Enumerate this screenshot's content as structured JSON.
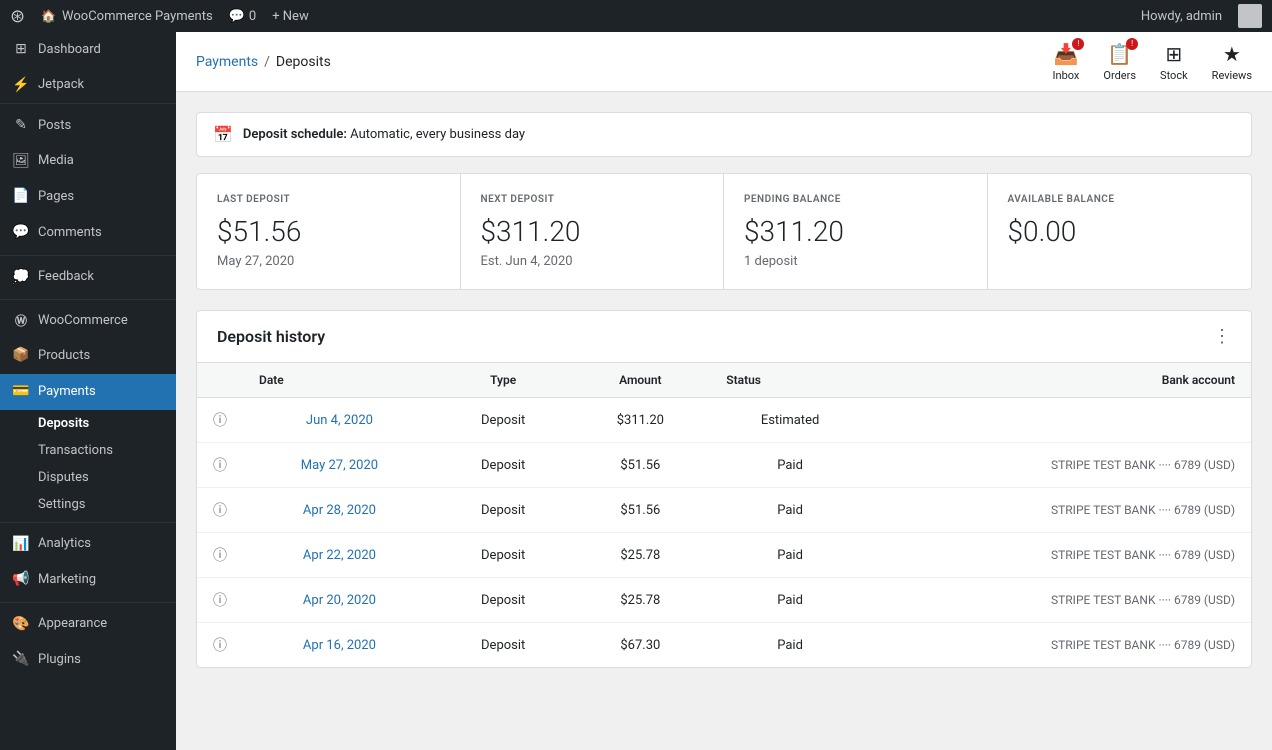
{
  "adminbar": {
    "logo": "W",
    "site_name": "WooCommerce Payments",
    "comments_label": "0",
    "new_label": "+ New",
    "user_label": "Howdy, admin"
  },
  "sidebar": {
    "items": [
      {
        "id": "dashboard",
        "label": "Dashboard",
        "icon": "⊞"
      },
      {
        "id": "jetpack",
        "label": "Jetpack",
        "icon": "⚡"
      },
      {
        "id": "posts",
        "label": "Posts",
        "icon": "✎"
      },
      {
        "id": "media",
        "label": "Media",
        "icon": "🖼"
      },
      {
        "id": "pages",
        "label": "Pages",
        "icon": "📄"
      },
      {
        "id": "comments",
        "label": "Comments",
        "icon": "💬"
      },
      {
        "id": "feedback",
        "label": "Feedback",
        "icon": "💭"
      },
      {
        "id": "woocommerce",
        "label": "WooCommerce",
        "icon": "Ⓦ"
      },
      {
        "id": "products",
        "label": "Products",
        "icon": "📦"
      },
      {
        "id": "payments",
        "label": "Payments",
        "icon": "💳",
        "active": true
      }
    ],
    "sub_items": [
      {
        "id": "deposits",
        "label": "Deposits",
        "active": true
      },
      {
        "id": "transactions",
        "label": "Transactions"
      },
      {
        "id": "disputes",
        "label": "Disputes"
      },
      {
        "id": "settings",
        "label": "Settings"
      }
    ],
    "bottom_items": [
      {
        "id": "analytics",
        "label": "Analytics",
        "icon": "📊"
      },
      {
        "id": "marketing",
        "label": "Marketing",
        "icon": "📢"
      },
      {
        "id": "appearance",
        "label": "Appearance",
        "icon": "🎨"
      },
      {
        "id": "plugins",
        "label": "Plugins",
        "icon": "🔌"
      }
    ]
  },
  "topbar": {
    "breadcrumb_parent": "Payments",
    "breadcrumb_separator": "/",
    "breadcrumb_current": "Deposits",
    "actions": [
      {
        "id": "inbox",
        "label": "Inbox",
        "icon": "📥",
        "badge": true
      },
      {
        "id": "orders",
        "label": "Orders",
        "icon": "📋",
        "badge": true
      },
      {
        "id": "stock",
        "label": "Stock",
        "icon": "⊞"
      },
      {
        "id": "reviews",
        "label": "Reviews",
        "icon": "★"
      }
    ]
  },
  "deposit_schedule": {
    "label": "Deposit schedule:",
    "value": "Automatic, every business day"
  },
  "stats": [
    {
      "id": "last-deposit",
      "label": "LAST DEPOSIT",
      "value": "$51.56",
      "sub": "May 27, 2020"
    },
    {
      "id": "next-deposit",
      "label": "NEXT DEPOSIT",
      "value": "$311.20",
      "sub": "Est. Jun 4, 2020"
    },
    {
      "id": "pending-balance",
      "label": "PENDING BALANCE",
      "value": "$311.20",
      "sub": "1 deposit"
    },
    {
      "id": "available-balance",
      "label": "AVAILABLE BALANCE",
      "value": "$0.00",
      "sub": ""
    }
  ],
  "deposit_history": {
    "title": "Deposit history",
    "columns": [
      "Date",
      "Type",
      "Amount",
      "Status",
      "Bank account"
    ],
    "rows": [
      {
        "date": "Jun 4, 2020",
        "type": "Deposit",
        "amount": "$311.20",
        "status": "Estimated",
        "bank": ""
      },
      {
        "date": "May 27, 2020",
        "type": "Deposit",
        "amount": "$51.56",
        "status": "Paid",
        "bank": "STRIPE TEST BANK ···· 6789 (USD)"
      },
      {
        "date": "Apr 28, 2020",
        "type": "Deposit",
        "amount": "$51.56",
        "status": "Paid",
        "bank": "STRIPE TEST BANK ···· 6789 (USD)"
      },
      {
        "date": "Apr 22, 2020",
        "type": "Deposit",
        "amount": "$25.78",
        "status": "Paid",
        "bank": "STRIPE TEST BANK ···· 6789 (USD)"
      },
      {
        "date": "Apr 20, 2020",
        "type": "Deposit",
        "amount": "$25.78",
        "status": "Paid",
        "bank": "STRIPE TEST BANK ···· 6789 (USD)"
      },
      {
        "date": "Apr 16, 2020",
        "type": "Deposit",
        "amount": "$67.30",
        "status": "Paid",
        "bank": "STRIPE TEST BANK ···· 6789 (USD)"
      }
    ]
  }
}
